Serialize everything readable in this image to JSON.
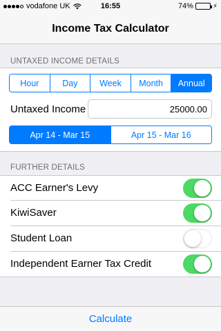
{
  "status_bar": {
    "carrier": "vodafone UK",
    "time": "16:55",
    "battery": "74%",
    "signal_icon": "signal-dots",
    "wifi_icon": "wifi",
    "battery_level": 0.74
  },
  "nav": {
    "title": "Income Tax Calculator"
  },
  "untaxed_section": {
    "header": "UNTAXED INCOME DETAILS",
    "periods": [
      "Hour",
      "Day",
      "Week",
      "Month",
      "Annual"
    ],
    "selected_period": "Annual",
    "income_label": "Untaxed Income",
    "income_value": "25000.00",
    "years": [
      "Apr 14 - Mar 15",
      "Apr 15 - Mar 16"
    ],
    "selected_year": "Apr 14 - Mar 15"
  },
  "further_section": {
    "header": "FURTHER DETAILS",
    "items": [
      {
        "label": "ACC Earner's Levy",
        "on": true
      },
      {
        "label": "KiwiSaver",
        "on": true
      },
      {
        "label": "Student Loan",
        "on": false
      },
      {
        "label": "Independent Earner Tax Credit",
        "on": true
      }
    ]
  },
  "footer": {
    "calculate_label": "Calculate"
  },
  "colors": {
    "accent": "#007aff",
    "switch_on": "#4cd964"
  }
}
